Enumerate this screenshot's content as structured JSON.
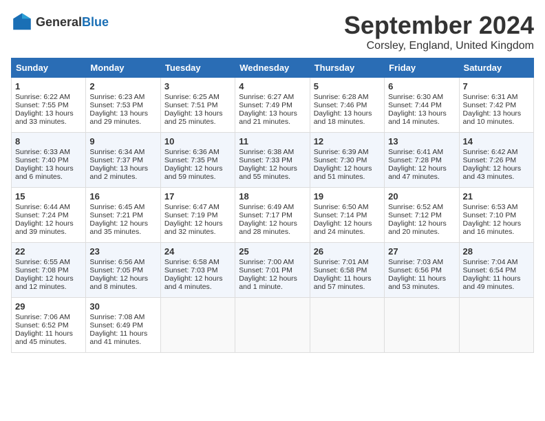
{
  "header": {
    "logo_line1": "General",
    "logo_line2": "Blue",
    "month_title": "September 2024",
    "location": "Corsley, England, United Kingdom"
  },
  "days_of_week": [
    "Sunday",
    "Monday",
    "Tuesday",
    "Wednesday",
    "Thursday",
    "Friday",
    "Saturday"
  ],
  "weeks": [
    [
      {
        "day": "1",
        "sunrise": "Sunrise: 6:22 AM",
        "sunset": "Sunset: 7:55 PM",
        "daylight": "Daylight: 13 hours and 33 minutes."
      },
      {
        "day": "2",
        "sunrise": "Sunrise: 6:23 AM",
        "sunset": "Sunset: 7:53 PM",
        "daylight": "Daylight: 13 hours and 29 minutes."
      },
      {
        "day": "3",
        "sunrise": "Sunrise: 6:25 AM",
        "sunset": "Sunset: 7:51 PM",
        "daylight": "Daylight: 13 hours and 25 minutes."
      },
      {
        "day": "4",
        "sunrise": "Sunrise: 6:27 AM",
        "sunset": "Sunset: 7:49 PM",
        "daylight": "Daylight: 13 hours and 21 minutes."
      },
      {
        "day": "5",
        "sunrise": "Sunrise: 6:28 AM",
        "sunset": "Sunset: 7:46 PM",
        "daylight": "Daylight: 13 hours and 18 minutes."
      },
      {
        "day": "6",
        "sunrise": "Sunrise: 6:30 AM",
        "sunset": "Sunset: 7:44 PM",
        "daylight": "Daylight: 13 hours and 14 minutes."
      },
      {
        "day": "7",
        "sunrise": "Sunrise: 6:31 AM",
        "sunset": "Sunset: 7:42 PM",
        "daylight": "Daylight: 13 hours and 10 minutes."
      }
    ],
    [
      {
        "day": "8",
        "sunrise": "Sunrise: 6:33 AM",
        "sunset": "Sunset: 7:40 PM",
        "daylight": "Daylight: 13 hours and 6 minutes."
      },
      {
        "day": "9",
        "sunrise": "Sunrise: 6:34 AM",
        "sunset": "Sunset: 7:37 PM",
        "daylight": "Daylight: 13 hours and 2 minutes."
      },
      {
        "day": "10",
        "sunrise": "Sunrise: 6:36 AM",
        "sunset": "Sunset: 7:35 PM",
        "daylight": "Daylight: 12 hours and 59 minutes."
      },
      {
        "day": "11",
        "sunrise": "Sunrise: 6:38 AM",
        "sunset": "Sunset: 7:33 PM",
        "daylight": "Daylight: 12 hours and 55 minutes."
      },
      {
        "day": "12",
        "sunrise": "Sunrise: 6:39 AM",
        "sunset": "Sunset: 7:30 PM",
        "daylight": "Daylight: 12 hours and 51 minutes."
      },
      {
        "day": "13",
        "sunrise": "Sunrise: 6:41 AM",
        "sunset": "Sunset: 7:28 PM",
        "daylight": "Daylight: 12 hours and 47 minutes."
      },
      {
        "day": "14",
        "sunrise": "Sunrise: 6:42 AM",
        "sunset": "Sunset: 7:26 PM",
        "daylight": "Daylight: 12 hours and 43 minutes."
      }
    ],
    [
      {
        "day": "15",
        "sunrise": "Sunrise: 6:44 AM",
        "sunset": "Sunset: 7:24 PM",
        "daylight": "Daylight: 12 hours and 39 minutes."
      },
      {
        "day": "16",
        "sunrise": "Sunrise: 6:45 AM",
        "sunset": "Sunset: 7:21 PM",
        "daylight": "Daylight: 12 hours and 35 minutes."
      },
      {
        "day": "17",
        "sunrise": "Sunrise: 6:47 AM",
        "sunset": "Sunset: 7:19 PM",
        "daylight": "Daylight: 12 hours and 32 minutes."
      },
      {
        "day": "18",
        "sunrise": "Sunrise: 6:49 AM",
        "sunset": "Sunset: 7:17 PM",
        "daylight": "Daylight: 12 hours and 28 minutes."
      },
      {
        "day": "19",
        "sunrise": "Sunrise: 6:50 AM",
        "sunset": "Sunset: 7:14 PM",
        "daylight": "Daylight: 12 hours and 24 minutes."
      },
      {
        "day": "20",
        "sunrise": "Sunrise: 6:52 AM",
        "sunset": "Sunset: 7:12 PM",
        "daylight": "Daylight: 12 hours and 20 minutes."
      },
      {
        "day": "21",
        "sunrise": "Sunrise: 6:53 AM",
        "sunset": "Sunset: 7:10 PM",
        "daylight": "Daylight: 12 hours and 16 minutes."
      }
    ],
    [
      {
        "day": "22",
        "sunrise": "Sunrise: 6:55 AM",
        "sunset": "Sunset: 7:08 PM",
        "daylight": "Daylight: 12 hours and 12 minutes."
      },
      {
        "day": "23",
        "sunrise": "Sunrise: 6:56 AM",
        "sunset": "Sunset: 7:05 PM",
        "daylight": "Daylight: 12 hours and 8 minutes."
      },
      {
        "day": "24",
        "sunrise": "Sunrise: 6:58 AM",
        "sunset": "Sunset: 7:03 PM",
        "daylight": "Daylight: 12 hours and 4 minutes."
      },
      {
        "day": "25",
        "sunrise": "Sunrise: 7:00 AM",
        "sunset": "Sunset: 7:01 PM",
        "daylight": "Daylight: 12 hours and 1 minute."
      },
      {
        "day": "26",
        "sunrise": "Sunrise: 7:01 AM",
        "sunset": "Sunset: 6:58 PM",
        "daylight": "Daylight: 11 hours and 57 minutes."
      },
      {
        "day": "27",
        "sunrise": "Sunrise: 7:03 AM",
        "sunset": "Sunset: 6:56 PM",
        "daylight": "Daylight: 11 hours and 53 minutes."
      },
      {
        "day": "28",
        "sunrise": "Sunrise: 7:04 AM",
        "sunset": "Sunset: 6:54 PM",
        "daylight": "Daylight: 11 hours and 49 minutes."
      }
    ],
    [
      {
        "day": "29",
        "sunrise": "Sunrise: 7:06 AM",
        "sunset": "Sunset: 6:52 PM",
        "daylight": "Daylight: 11 hours and 45 minutes."
      },
      {
        "day": "30",
        "sunrise": "Sunrise: 7:08 AM",
        "sunset": "Sunset: 6:49 PM",
        "daylight": "Daylight: 11 hours and 41 minutes."
      },
      null,
      null,
      null,
      null,
      null
    ]
  ]
}
